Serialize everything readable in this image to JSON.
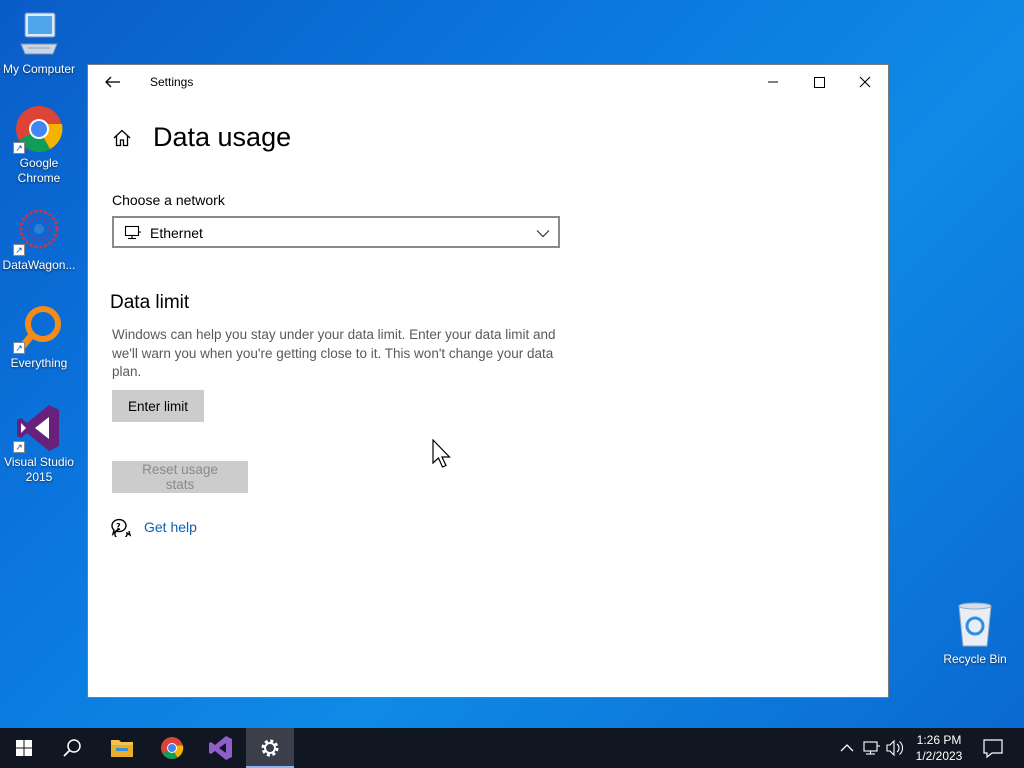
{
  "desktop": {
    "icons": [
      {
        "label": "My Computer"
      },
      {
        "label": "Google Chrome"
      },
      {
        "label": "DataWagon..."
      },
      {
        "label": "Everything"
      },
      {
        "label": "Visual Studio 2015"
      },
      {
        "label": "Recycle Bin"
      }
    ]
  },
  "window": {
    "title": "Settings",
    "page_title": "Data usage",
    "network_label": "Choose a network",
    "network_selected": "Ethernet",
    "data_limit_title": "Data limit",
    "data_limit_desc": "Windows can help you stay under your data limit. Enter your data limit and we'll warn you when you're getting close to it. This won't change your data plan.",
    "enter_limit_label": "Enter limit",
    "reset_label": "Reset usage stats",
    "help_label": "Get help"
  },
  "taskbar": {
    "time": "1:26 PM",
    "date": "1/2/2023"
  },
  "colors": {
    "link": "#0a62b0",
    "button_bg": "#cccccc",
    "taskbar_bg": "#101622"
  }
}
